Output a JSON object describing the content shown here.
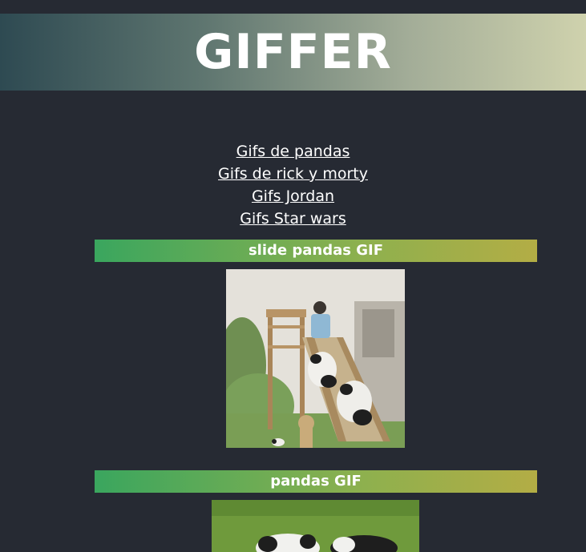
{
  "header": {
    "title": "GIFFER"
  },
  "nav": {
    "links": [
      "Gifs de pandas",
      "Gifs de rick y morty",
      "Gifs Jordan",
      "Gifs Star wars"
    ]
  },
  "sections": [
    {
      "title": "slide pandas GIF"
    },
    {
      "title": "pandas GIF"
    }
  ],
  "colors": {
    "background": "#262a33",
    "header_gradient_start": "#2e4a52",
    "header_gradient_end": "#cfd2ad",
    "bar_gradient_start": "#3aa65e",
    "bar_gradient_end": "#b3ad45",
    "text": "#ffffff"
  }
}
